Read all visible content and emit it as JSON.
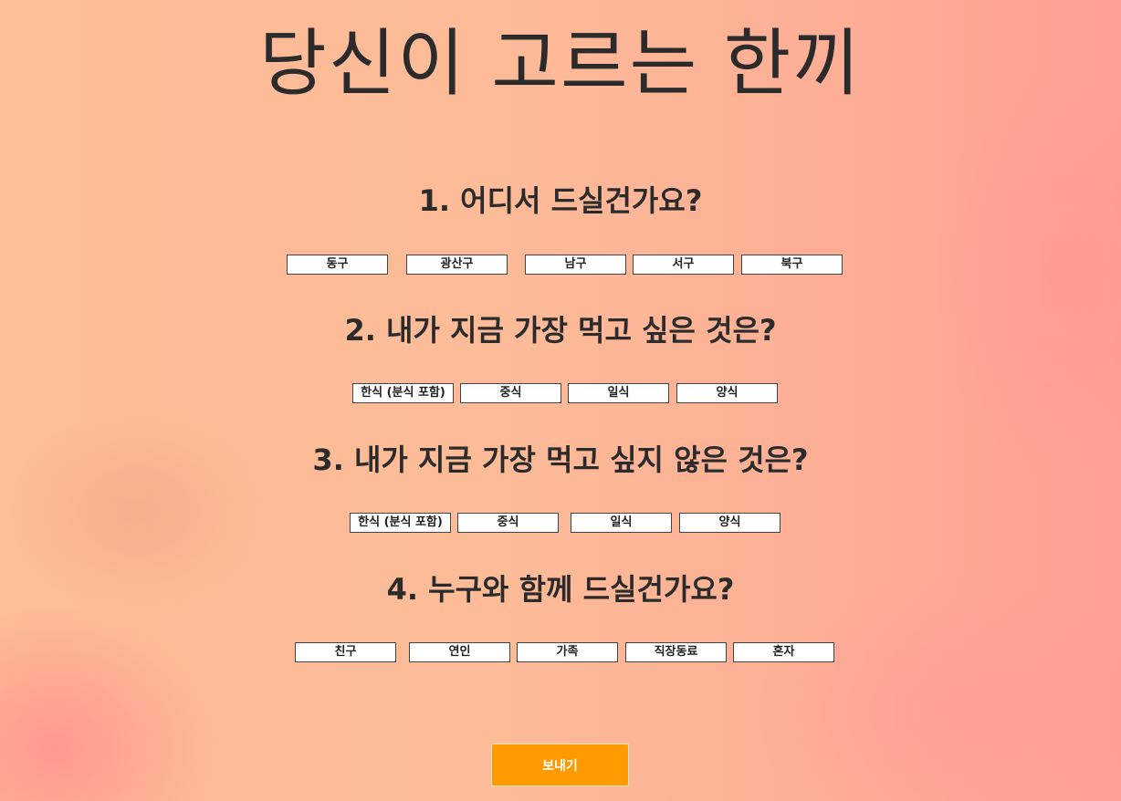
{
  "title": "당신이 고르는 한끼",
  "questions": [
    {
      "title": "1. 어디서 드실건가요?",
      "options": [
        "동구",
        "광산구",
        "남구",
        "서구",
        "북구"
      ]
    },
    {
      "title": "2. 내가 지금 가장 먹고 싶은 것은?",
      "options": [
        "한식 (분식 포함)",
        "중식",
        "일식",
        "양식"
      ]
    },
    {
      "title": "3. 내가 지금 가장 먹고 싶지 않은 것은?",
      "options": [
        "한식 (분식 포함)",
        "중식",
        "일식",
        "양식"
      ]
    },
    {
      "title": "4. 누구와 함께 드실건가요?",
      "options": [
        "친구",
        "연인",
        "가족",
        "직장동료",
        "혼자"
      ]
    }
  ],
  "submit_label": "보내기",
  "colors": {
    "accent": "#ff9a00",
    "text": "#2b2b2b",
    "background_start": "#fdbd96",
    "background_end": "#fd9f91"
  }
}
